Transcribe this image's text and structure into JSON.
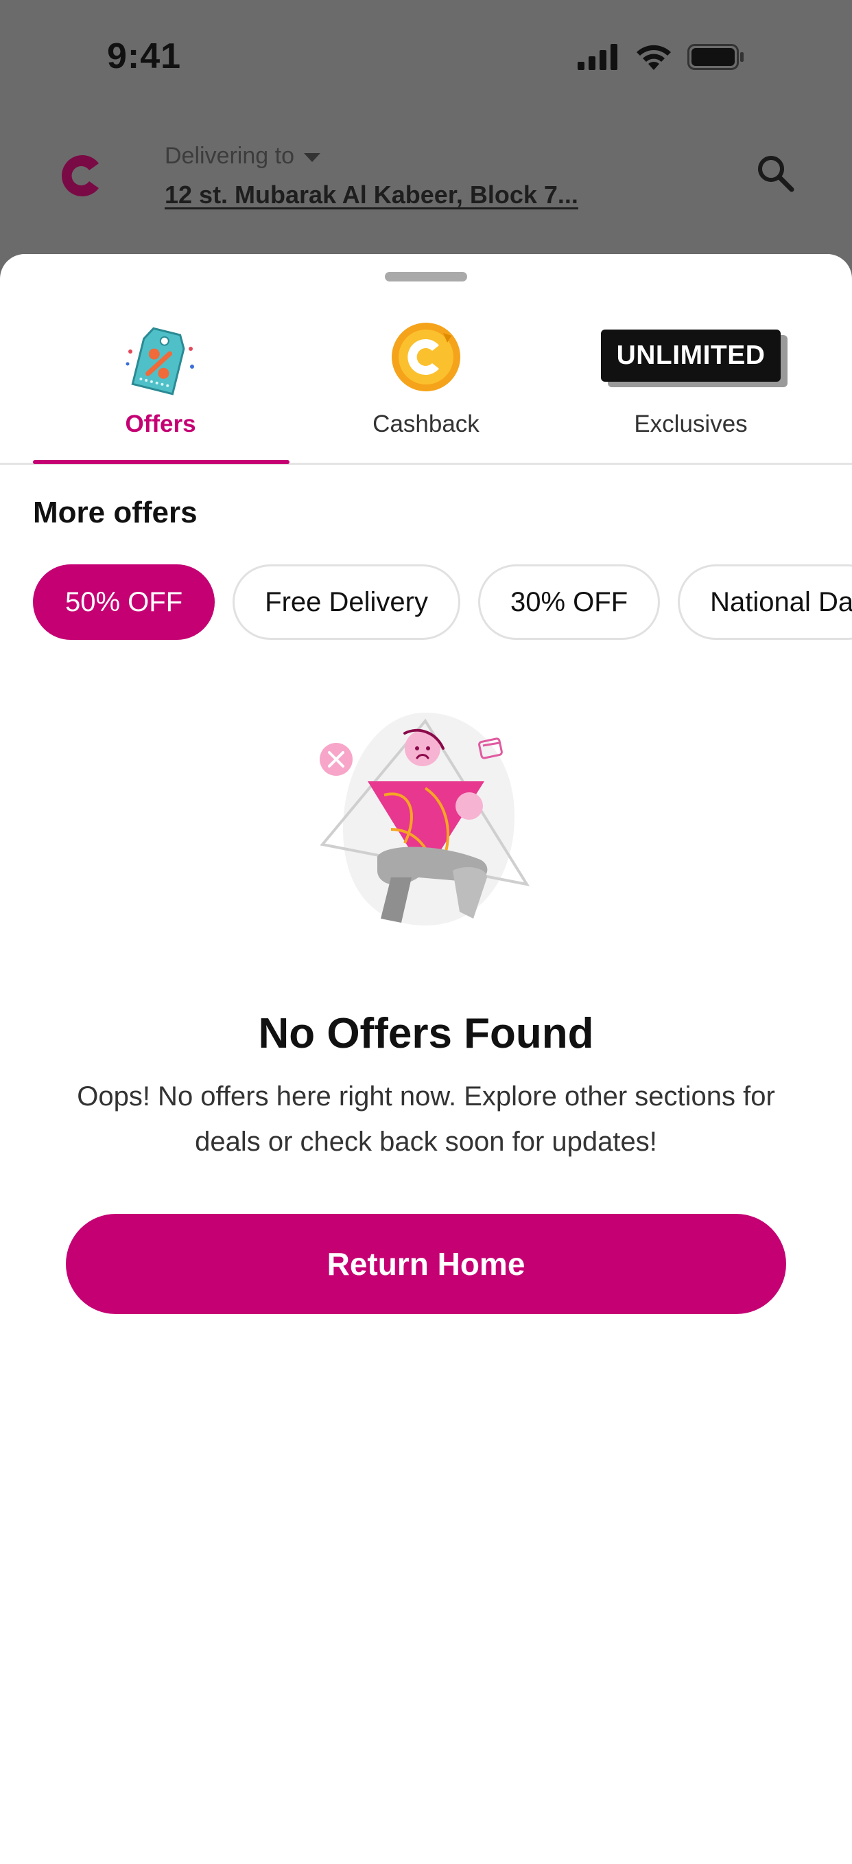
{
  "status_bar": {
    "time": "9:41",
    "icons": [
      "cellular-signal-icon",
      "wifi-icon",
      "battery-icon"
    ]
  },
  "header": {
    "logo": "c-brand-logo",
    "delivering_label": "Delivering to",
    "address": "12 st. Mubarak Al Kabeer, Block 7...",
    "search_icon": "search-icon"
  },
  "tabs": [
    {
      "label": "Offers",
      "icon": "percent-tag-icon",
      "active": true
    },
    {
      "label": "Cashback",
      "icon": "cashback-coin-icon",
      "active": false
    },
    {
      "label": "Exclusives",
      "icon": "unlimited-badge",
      "badge_text": "UNLIMITED",
      "active": false
    }
  ],
  "section_title": "More offers",
  "chips": [
    {
      "label": "50% OFF",
      "selected": true
    },
    {
      "label": "Free Delivery",
      "selected": false
    },
    {
      "label": "30% OFF",
      "selected": false
    },
    {
      "label": "National Da",
      "selected": false
    }
  ],
  "empty_state": {
    "illustration": "sad-figure-illustration",
    "title": "No Offers Found",
    "message": "Oops! No offers here right now. Explore other sections for deals or check back soon for updates!",
    "button_label": "Return Home"
  },
  "colors": {
    "accent": "#C50073",
    "overlay": "#6B6B6B",
    "text": "#111111"
  }
}
